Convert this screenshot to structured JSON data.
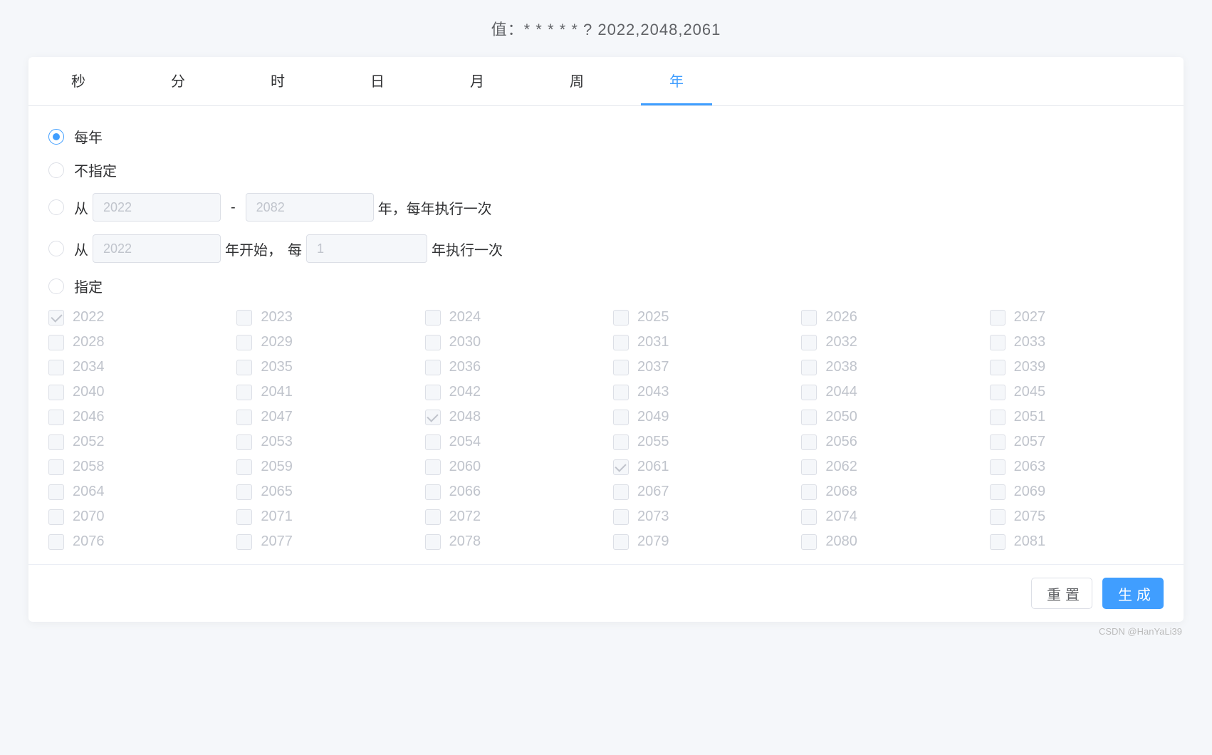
{
  "header": {
    "prefix": "值：",
    "value": "* * * * * ? 2022,2048,2061"
  },
  "tabs": [
    {
      "label": "秒",
      "active": false
    },
    {
      "label": "分",
      "active": false
    },
    {
      "label": "时",
      "active": false
    },
    {
      "label": "日",
      "active": false
    },
    {
      "label": "月",
      "active": false
    },
    {
      "label": "周",
      "active": false
    },
    {
      "label": "年",
      "active": true
    }
  ],
  "radios": {
    "every": {
      "label": "每年",
      "selected": true
    },
    "none": {
      "label": "不指定",
      "selected": false
    },
    "range": {
      "selected": false,
      "prefix": "从",
      "from": "2022",
      "to": "2082",
      "suffix": "年，每年执行一次"
    },
    "interval": {
      "selected": false,
      "prefix": "从",
      "start": "2022",
      "mid1": "年开始，",
      "mid2": "每",
      "step": "1",
      "suffix": "年执行一次"
    },
    "specify": {
      "label": "指定",
      "selected": false
    }
  },
  "years": [
    {
      "y": "2022",
      "c": true
    },
    {
      "y": "2023",
      "c": false
    },
    {
      "y": "2024",
      "c": false
    },
    {
      "y": "2025",
      "c": false
    },
    {
      "y": "2026",
      "c": false
    },
    {
      "y": "2027",
      "c": false
    },
    {
      "y": "2028",
      "c": false
    },
    {
      "y": "2029",
      "c": false
    },
    {
      "y": "2030",
      "c": false
    },
    {
      "y": "2031",
      "c": false
    },
    {
      "y": "2032",
      "c": false
    },
    {
      "y": "2033",
      "c": false
    },
    {
      "y": "2034",
      "c": false
    },
    {
      "y": "2035",
      "c": false
    },
    {
      "y": "2036",
      "c": false
    },
    {
      "y": "2037",
      "c": false
    },
    {
      "y": "2038",
      "c": false
    },
    {
      "y": "2039",
      "c": false
    },
    {
      "y": "2040",
      "c": false
    },
    {
      "y": "2041",
      "c": false
    },
    {
      "y": "2042",
      "c": false
    },
    {
      "y": "2043",
      "c": false
    },
    {
      "y": "2044",
      "c": false
    },
    {
      "y": "2045",
      "c": false
    },
    {
      "y": "2046",
      "c": false
    },
    {
      "y": "2047",
      "c": false
    },
    {
      "y": "2048",
      "c": true
    },
    {
      "y": "2049",
      "c": false
    },
    {
      "y": "2050",
      "c": false
    },
    {
      "y": "2051",
      "c": false
    },
    {
      "y": "2052",
      "c": false
    },
    {
      "y": "2053",
      "c": false
    },
    {
      "y": "2054",
      "c": false
    },
    {
      "y": "2055",
      "c": false
    },
    {
      "y": "2056",
      "c": false
    },
    {
      "y": "2057",
      "c": false
    },
    {
      "y": "2058",
      "c": false
    },
    {
      "y": "2059",
      "c": false
    },
    {
      "y": "2060",
      "c": false
    },
    {
      "y": "2061",
      "c": true
    },
    {
      "y": "2062",
      "c": false
    },
    {
      "y": "2063",
      "c": false
    },
    {
      "y": "2064",
      "c": false
    },
    {
      "y": "2065",
      "c": false
    },
    {
      "y": "2066",
      "c": false
    },
    {
      "y": "2067",
      "c": false
    },
    {
      "y": "2068",
      "c": false
    },
    {
      "y": "2069",
      "c": false
    },
    {
      "y": "2070",
      "c": false
    },
    {
      "y": "2071",
      "c": false
    },
    {
      "y": "2072",
      "c": false
    },
    {
      "y": "2073",
      "c": false
    },
    {
      "y": "2074",
      "c": false
    },
    {
      "y": "2075",
      "c": false
    },
    {
      "y": "2076",
      "c": false
    },
    {
      "y": "2077",
      "c": false
    },
    {
      "y": "2078",
      "c": false
    },
    {
      "y": "2079",
      "c": false
    },
    {
      "y": "2080",
      "c": false
    },
    {
      "y": "2081",
      "c": false
    }
  ],
  "footer": {
    "reset": "重置",
    "generate": "生成"
  },
  "watermark": "CSDN @HanYaLi39"
}
